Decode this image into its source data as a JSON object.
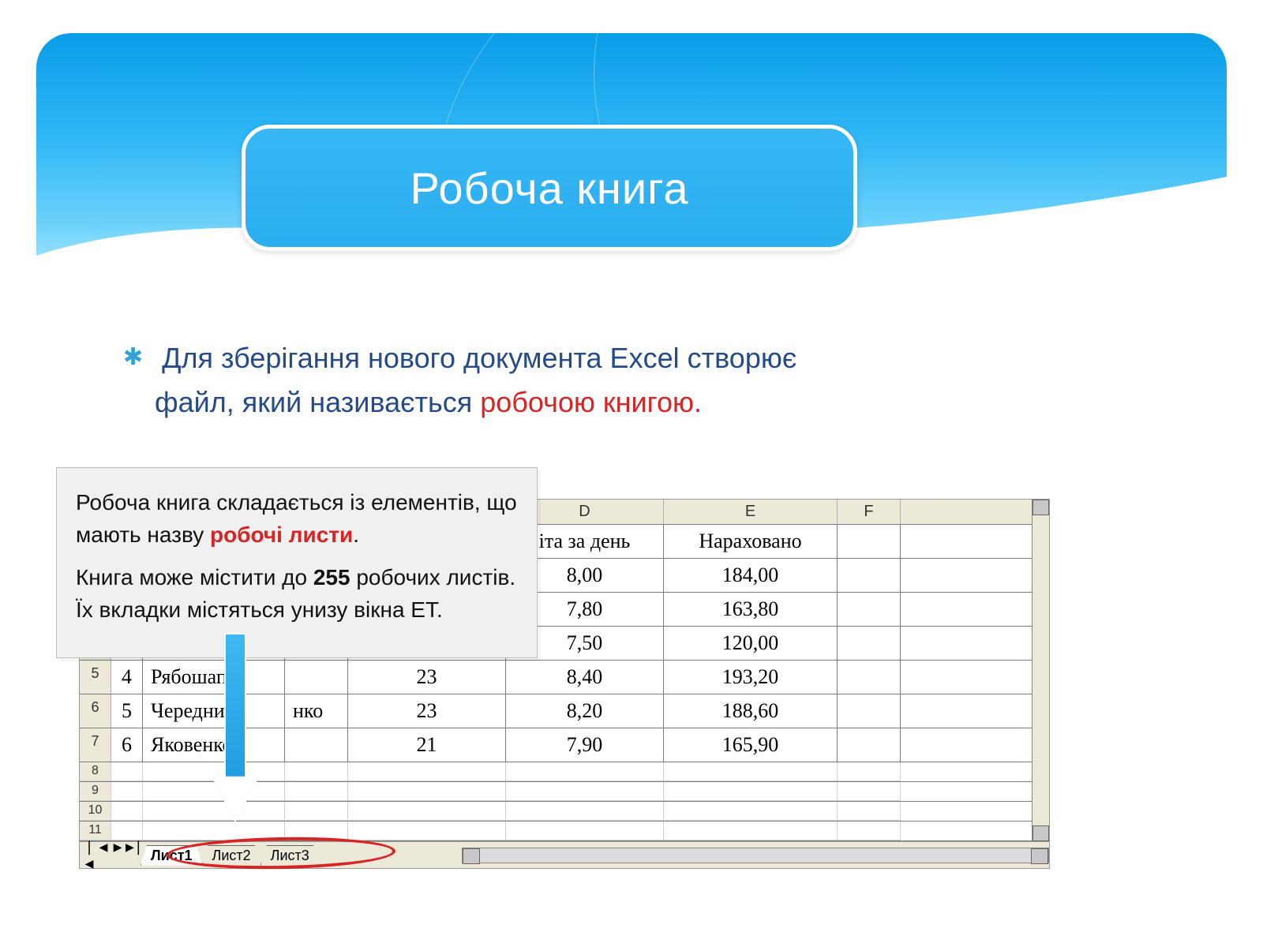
{
  "title": "Робоча книга",
  "body": {
    "bullet": "✱",
    "line1": "Для зберігання нового документа Excel створює",
    "line2_pre": "файл, який називається ",
    "line2_red": "робочою книгою."
  },
  "callout": {
    "p1_pre": "Робоча книга складається із елементів, що мають назву ",
    "p1_red": "робочі листи",
    "p1_post": ".",
    "p2_pre": "Книга може містити до ",
    "p2_bold": "255",
    "p2_mid": " робочих листів. Їх вкладки містяться унизу вікна ЕТ."
  },
  "excel": {
    "col_headers": [
      "",
      "",
      "",
      "",
      "",
      "D",
      "E",
      "F"
    ],
    "header_row": {
      "rh": "",
      "n": "",
      "name": "",
      "ext": "",
      "c": "",
      "d": "іта за день",
      "e": "Нараховано",
      "f": ""
    },
    "rows": [
      {
        "rh": "",
        "n": "",
        "name": "",
        "ext": "",
        "c": "",
        "d": "8,00",
        "e": "184,00",
        "f": ""
      },
      {
        "rh": "",
        "n": "",
        "name": "",
        "ext": "",
        "c": "",
        "d": "7,80",
        "e": "163,80",
        "f": ""
      },
      {
        "rh": "",
        "n": "",
        "name": "",
        "ext": "",
        "c": "",
        "d": "7,50",
        "e": "120,00",
        "f": ""
      },
      {
        "rh": "5",
        "n": "4",
        "name": "Рябошап",
        "ext": "",
        "c": "23",
        "d": "8,40",
        "e": "193,20",
        "f": ""
      },
      {
        "rh": "6",
        "n": "5",
        "name": "Череднич",
        "ext": "нко",
        "c": "23",
        "d": "8,20",
        "e": "188,60",
        "f": ""
      },
      {
        "rh": "7",
        "n": "6",
        "name": "Яковенко",
        "ext": "",
        "c": "21",
        "d": "7,90",
        "e": "165,90",
        "f": ""
      }
    ],
    "thin_rows": [
      "8",
      "9",
      "10",
      "11"
    ],
    "tabs": {
      "nav": [
        "|◀",
        "◀",
        "▶",
        "▶|"
      ],
      "items": [
        "Лист1",
        "Лист2",
        "Лист3"
      ]
    }
  }
}
